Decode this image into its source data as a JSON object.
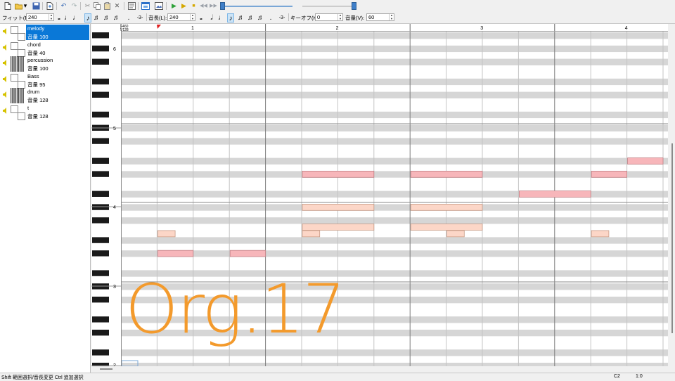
{
  "toolbar": {
    "fit_label": "フィット(F):",
    "fit_value": "240",
    "length_label": "音長(L):",
    "length_value": "240",
    "keyoff_label": "キーオフ(K):",
    "keyoff_value": "0",
    "volume_label": "音量(V):",
    "volume_value": "60"
  },
  "tracks": [
    {
      "name": "melody",
      "volume": "音量 100",
      "selected": true
    },
    {
      "name": "chord",
      "volume": "音量 40",
      "selected": false
    },
    {
      "name": "percussion",
      "volume": "音量 100",
      "selected": false
    },
    {
      "name": "Bass",
      "volume": "音量 95",
      "selected": false
    },
    {
      "name": "drum",
      "volume": "音量 128",
      "selected": false
    },
    {
      "name": "t",
      "volume": "音量 128",
      "selected": false
    }
  ],
  "ruler": {
    "tempo_line1": "F460",
    "tempo_line2": "V128",
    "measures": [
      "1",
      "2",
      "3",
      "4"
    ]
  },
  "octave_labels": [
    "6",
    "5",
    "4",
    "3",
    "2"
  ],
  "watermark": "Org.17",
  "status": {
    "hint": "Shift 範囲選択/音長変更  Ctrl 追加選択",
    "note": "C2",
    "position": "1:0"
  },
  "colors": {
    "accent": "#0a78d7",
    "melody_note": "#f7b6ba",
    "chord_note": "#fcd6c7",
    "watermark": "#f39a2c"
  }
}
